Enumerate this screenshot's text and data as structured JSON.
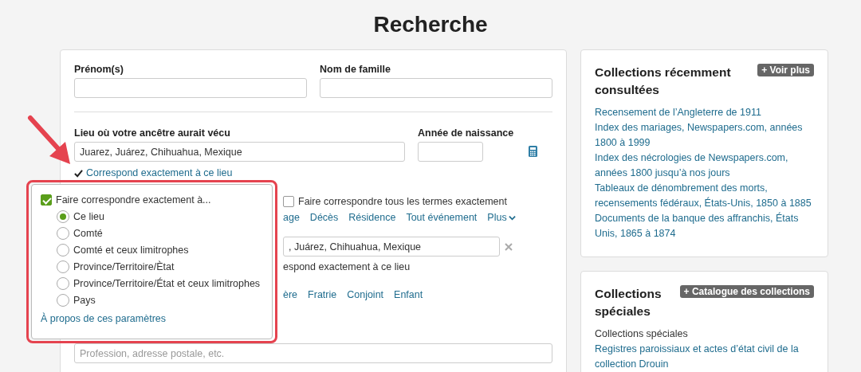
{
  "title": "Recherche",
  "form": {
    "fields": [
      {
        "label": "Prénom(s)"
      },
      {
        "label": "Nom de famille"
      }
    ],
    "place": {
      "label": "Lieu où votre ancêtre aurait vécu",
      "value": "Juarez, Juárez, Chihuahua, Mexique",
      "exact_match": {
        "label": "Correspond exactement à ce lieu",
        "checked": true
      }
    },
    "birth_year": {
      "label": "Année de naissance"
    },
    "match_all": {
      "label": "Faire correspondre tous les termes exactement",
      "checked": false
    },
    "event_links": [
      "age",
      "Décès",
      "Résidence",
      "Tout événement",
      "Plus"
    ],
    "event_place": {
      "value": ", Juárez, Chihuahua, Mexique"
    },
    "event_exact_match": "espond exactement à ce lieu",
    "relation_links": [
      "ère",
      "Fratrie",
      "Conjoint",
      "Enfant"
    ],
    "keywords": {
      "placeholder": "Profession, adresse postale, etc."
    }
  },
  "popover": {
    "checkbox": {
      "label": "Faire correspondre exactement à...",
      "checked": true
    },
    "options": [
      {
        "label": "Ce lieu",
        "selected": true
      },
      {
        "label": "Comté",
        "selected": false
      },
      {
        "label": "Comté et ceux limitrophes",
        "selected": false
      },
      {
        "label": "Province/Territoire/Ètat",
        "selected": false
      },
      {
        "label": "Province/Territoire/État et ceux limitrophes",
        "selected": false
      },
      {
        "label": "Pays",
        "selected": false
      }
    ],
    "link": "À propos de ces paramètres"
  },
  "sidebar": [
    {
      "title": "Collections récemment consultées",
      "button": "+ Voir plus",
      "items": [
        {
          "kind": "link",
          "text": "Recensement de l’Angleterre de 1911"
        },
        {
          "kind": "link",
          "text": "Index des mariages, Newspapers.com, années 1800 à 1999"
        },
        {
          "kind": "link",
          "text": "Index des nécrologies de Newspapers.com, années 1800 jusqu’à nos jours"
        },
        {
          "kind": "link",
          "text": "Tableaux de dénombrement des morts, recensements fédéraux, États-Unis, 1850 à 1885"
        },
        {
          "kind": "link",
          "text": "Documents de la banque des affranchis, États Unis, 1865 à 1874"
        }
      ]
    },
    {
      "title": "Collections spéciales",
      "button": "+ Catalogue des collections",
      "items": [
        {
          "kind": "text",
          "text": "Collections spéciales"
        },
        {
          "kind": "link",
          "text": "Registres paroissiaux et actes d’état civil de la collection Drouin"
        }
      ]
    }
  ]
}
